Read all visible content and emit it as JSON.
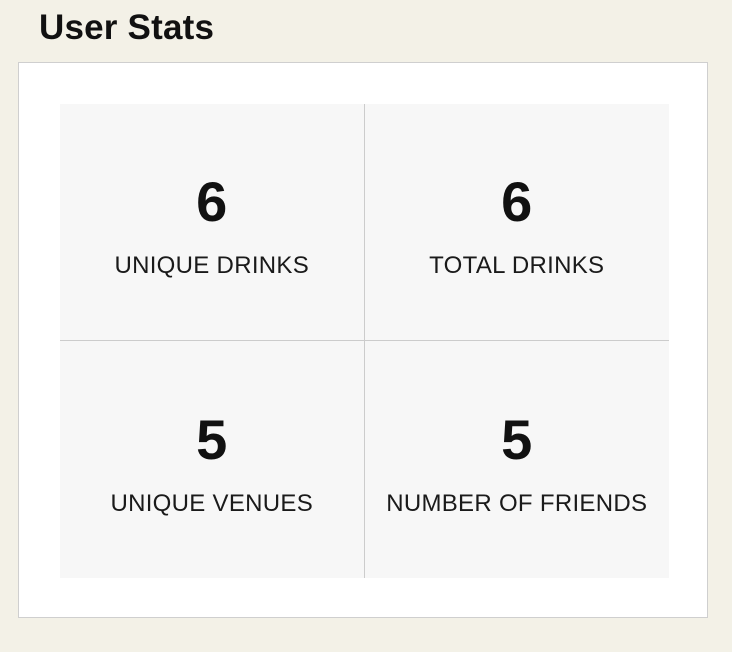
{
  "header": {
    "title": "User Stats"
  },
  "stats": [
    {
      "value": "6",
      "label": "UNIQUE DRINKS"
    },
    {
      "value": "6",
      "label": "TOTAL DRINKS"
    },
    {
      "value": "5",
      "label": "UNIQUE VENUES"
    },
    {
      "value": "5",
      "label": "NUMBER OF FRIENDS"
    }
  ],
  "colors": {
    "page_background": "#f3f1e7",
    "card_background": "#ffffff",
    "tile_background": "#f7f7f7",
    "divider": "#cccccc",
    "text": "#111111"
  }
}
